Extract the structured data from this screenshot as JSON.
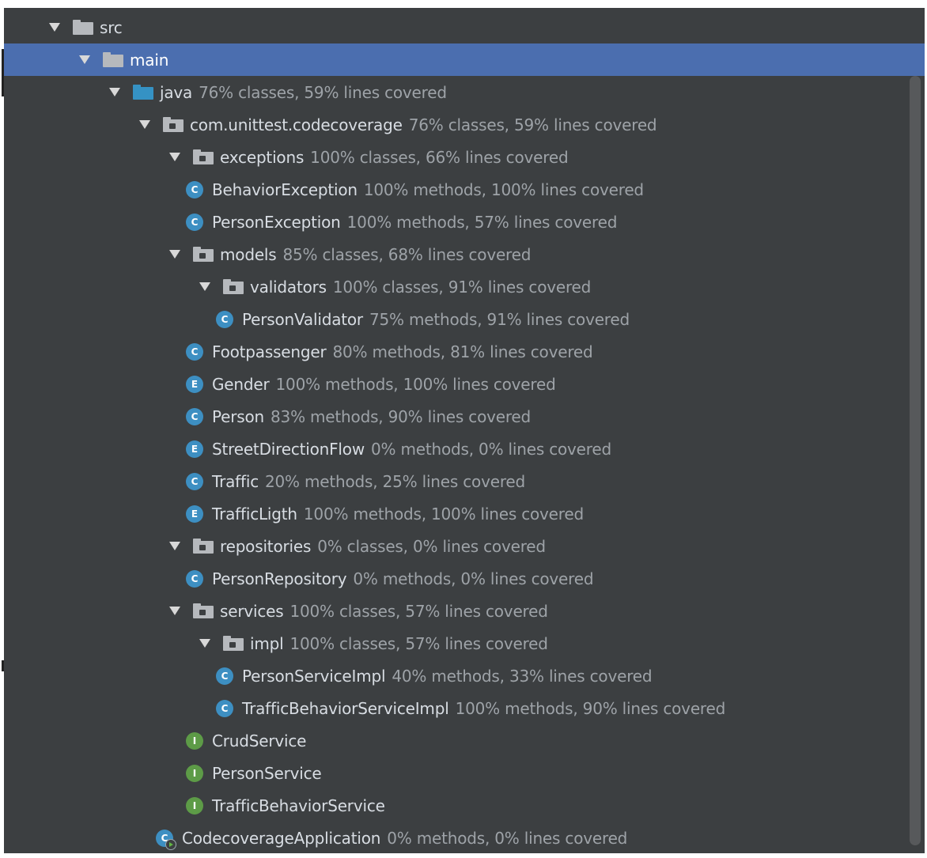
{
  "tree": [
    {
      "name": "src",
      "stats": "",
      "kind": "folder-plain",
      "level": 0,
      "expanded": true,
      "selected": false
    },
    {
      "name": "main",
      "stats": "",
      "kind": "folder-plain",
      "level": 1,
      "expanded": true,
      "selected": true
    },
    {
      "name": "java",
      "stats": "76% classes, 59% lines covered",
      "kind": "folder-source",
      "level": 2,
      "expanded": true,
      "selected": false
    },
    {
      "name": "com.unittest.codecoverage",
      "stats": "76% classes, 59% lines covered",
      "kind": "package",
      "level": 3,
      "expanded": true,
      "selected": false
    },
    {
      "name": "exceptions",
      "stats": "100% classes, 66% lines covered",
      "kind": "package",
      "level": 4,
      "expanded": true,
      "selected": false
    },
    {
      "name": "BehaviorException",
      "stats": "100% methods, 100% lines covered",
      "kind": "class",
      "level": 5,
      "selected": false
    },
    {
      "name": "PersonException",
      "stats": "100% methods, 57% lines covered",
      "kind": "class",
      "level": 5,
      "selected": false
    },
    {
      "name": "models",
      "stats": "85% classes, 68% lines covered",
      "kind": "package",
      "level": 4,
      "expanded": true,
      "selected": false
    },
    {
      "name": "validators",
      "stats": "100% classes, 91% lines covered",
      "kind": "package",
      "level": 5,
      "expanded": true,
      "selected": false
    },
    {
      "name": "PersonValidator",
      "stats": "75% methods, 91% lines covered",
      "kind": "class",
      "level": 6,
      "selected": false
    },
    {
      "name": "Footpassenger",
      "stats": "80% methods, 81% lines covered",
      "kind": "class",
      "level": 5,
      "selected": false
    },
    {
      "name": "Gender",
      "stats": "100% methods, 100% lines covered",
      "kind": "enum",
      "level": 5,
      "selected": false
    },
    {
      "name": "Person",
      "stats": "83% methods, 90% lines covered",
      "kind": "class",
      "level": 5,
      "selected": false
    },
    {
      "name": "StreetDirectionFlow",
      "stats": "0% methods, 0% lines covered",
      "kind": "enum",
      "level": 5,
      "selected": false
    },
    {
      "name": "Traffic",
      "stats": "20% methods, 25% lines covered",
      "kind": "class",
      "level": 5,
      "selected": false
    },
    {
      "name": "TrafficLigth",
      "stats": "100% methods, 100% lines covered",
      "kind": "enum",
      "level": 5,
      "selected": false
    },
    {
      "name": "repositories",
      "stats": "0% classes, 0% lines covered",
      "kind": "package",
      "level": 4,
      "expanded": true,
      "selected": false
    },
    {
      "name": "PersonRepository",
      "stats": "0% methods, 0% lines covered",
      "kind": "class",
      "level": 5,
      "selected": false
    },
    {
      "name": "services",
      "stats": "100% classes, 57% lines covered",
      "kind": "package",
      "level": 4,
      "expanded": true,
      "selected": false
    },
    {
      "name": "impl",
      "stats": "100% classes, 57% lines covered",
      "kind": "package",
      "level": 5,
      "expanded": true,
      "selected": false
    },
    {
      "name": "PersonServiceImpl",
      "stats": "40% methods, 33% lines covered",
      "kind": "class",
      "level": 6,
      "selected": false
    },
    {
      "name": "TrafficBehaviorServiceImpl",
      "stats": "100% methods, 90% lines covered",
      "kind": "class",
      "level": 6,
      "selected": false
    },
    {
      "name": "CrudService",
      "stats": "",
      "kind": "interface",
      "level": 5,
      "selected": false
    },
    {
      "name": "PersonService",
      "stats": "",
      "kind": "interface",
      "level": 5,
      "selected": false
    },
    {
      "name": "TrafficBehaviorService",
      "stats": "",
      "kind": "interface",
      "level": 5,
      "selected": false
    },
    {
      "name": "CodecoverageApplication",
      "stats": "0% methods, 0% lines covered",
      "kind": "application",
      "level": 4,
      "selected": false
    }
  ],
  "icons": {
    "class": {
      "name": "class-icon",
      "glyph": "C",
      "color": "#3d8fc2"
    },
    "enum": {
      "name": "enum-icon",
      "glyph": "E",
      "color": "#3d8fc2"
    },
    "interface": {
      "name": "interface-icon",
      "glyph": "I",
      "color": "#5d9b47"
    },
    "application": {
      "name": "spring-application-icon",
      "glyph": "C",
      "color": "#3d8fc2"
    },
    "package": {
      "name": "package-folder-icon"
    },
    "folder-plain": {
      "name": "folder-icon"
    },
    "folder-source": {
      "name": "source-folder-icon",
      "color": "#3592c4"
    },
    "arrow": {
      "name": "expand-arrow-icon"
    }
  },
  "colors": {
    "background": "#3c3f41",
    "selection": "#4b6eaf",
    "name_text": "#d8dde3",
    "stats_text": "#9ea3a8"
  }
}
